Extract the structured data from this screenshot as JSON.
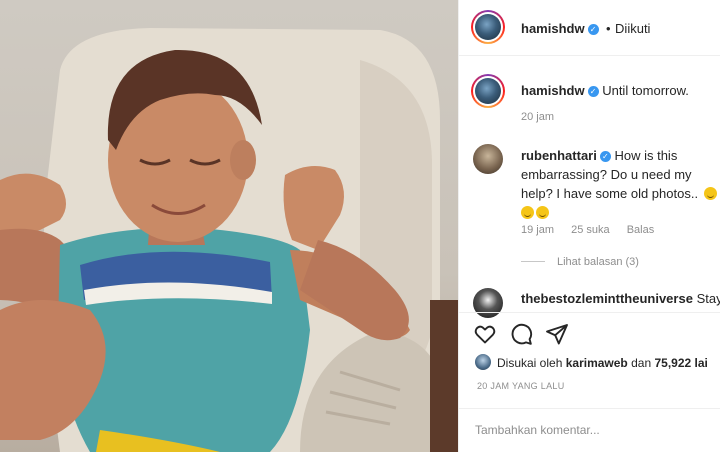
{
  "header": {
    "username": "hamishdw",
    "separator": "•",
    "follow_status": "Diikuti"
  },
  "caption": {
    "username": "hamishdw",
    "text": "Until tomorrow.",
    "time": "20 jam"
  },
  "comments": [
    {
      "username": "rubenhattari",
      "text": "How is this embarrassing? Do u need my help? I have some old photos..",
      "emoji": "😹😹😹",
      "time": "19 jam",
      "likes": "25 suka",
      "reply": "Balas",
      "view_replies": "Lihat balasan (3)"
    },
    {
      "username": "thebestozleminthe universe",
      "username_display": "thebestozleminttheuniverse",
      "text": "Stay"
    }
  ],
  "likes": {
    "prefix": "Disukai oleh",
    "user": "karimaweb",
    "conjunction": "dan",
    "count": "75,922 lai"
  },
  "post_time": "20 JAM YANG LALU",
  "add_comment_placeholder": "Tambahkan komentar...",
  "icons": {
    "like": "heart-icon",
    "comment": "comment-icon",
    "share": "paper-plane-icon",
    "verified": "verified-badge-icon"
  },
  "colors": {
    "verified": "#3897f0",
    "muted": "#8e8e8e",
    "border": "#efefef"
  }
}
